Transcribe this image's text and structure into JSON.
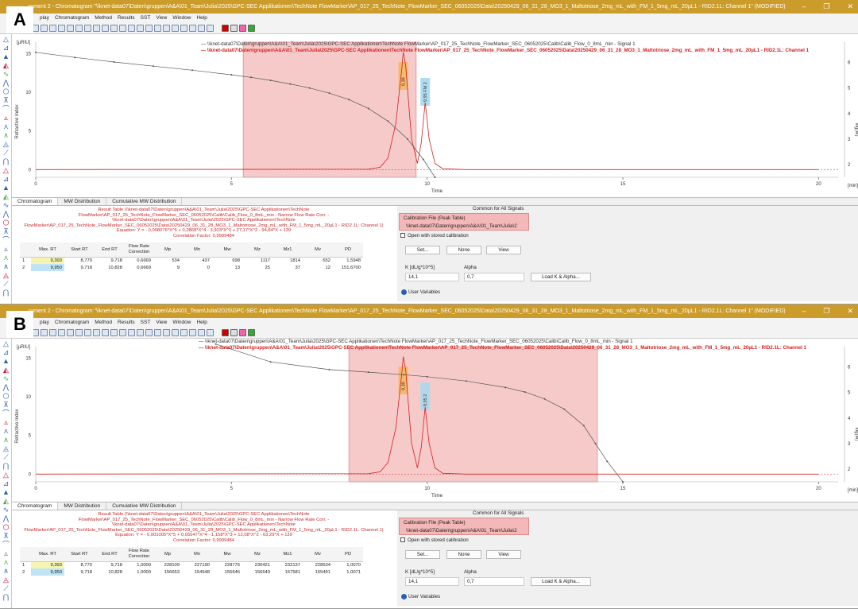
{
  "panels": [
    {
      "label": "A",
      "window_title": "rument 2 - Chromatogram \"\\\\knet-data07\\Daten\\gruppen\\A&A\\01_Team\\Julia\\2025\\GPC-SEC Applikationen\\TechNote FlowMarker\\AP_017_25_TechNote_FlowMarker_SEC_06052025\\Data\\20250429_06_31_28_MO3_1_Maltotriose_2mg_mL_with_FM_1_5mg_mL_20µL1 - RID2.1L: Channel 1\" (MODIFIED)",
      "legend_line1": "— \\\\knet-data07\\Daten\\gruppen\\A&A\\01_Team\\Julia\\2025\\GPC-SEC Applikationen\\TechNote FlowMarker\\AP_017_25_TechNote_FlowMarker_SEC_06052025\\Calib\\Calib_Flow_0_8mL_min - Signal 1",
      "legend_line2": "— \\\\knet-data07\\Daten\\gruppen\\A&A\\01_Team\\Julia\\2025\\GPC-SEC Applikationen\\TechNote FlowMarker\\AP_017_25_TechNote_FlowMarker_SEC_06052025\\Data\\20250429_06_31_28_MO3_1_Maltotriose_2mg_mL_with_FM_1_5mg_mL_20µL1 - RID2.1L: Channel 1",
      "result_info": [
        "Result Table (\\\\knet-data07\\Daten\\gruppen\\A&A\\01_Team\\Julia\\2025\\GPC-SEC Applikationen\\TechNote",
        "FlowMarker\\AP_017_25_TechNote_FlowMarker_SEC_06052025\\Calib\\Calib_Flow_0_8mL_min - Narrow Flow Rate Corr. -",
        "\\\\knet-data07\\Daten\\gruppen\\A&A\\01_Team\\Julia\\2025\\GPC-SEC Applikationen\\TechNote",
        "FlowMarker\\AP_017_25_TechNote_FlowMarker_SEC_06052025\\Data\\20250429_06_31_28_MO3_1_Maltotriose_2mg_mL_with_FM_1_5mg_mL_20µL1 - RID2.1L: Channel 1)",
        "Equation: Y = - 0,008076*X^5 + 0,2868*X^4 - 3,903*X^3 + 27,17*X^2 - 94,84*X + 139",
        "Correlation Factor: 0,9999484"
      ],
      "rows": [
        [
          "1",
          "9,393",
          "8,770",
          "9,718",
          "0,6669",
          "534",
          "437",
          "698",
          "1117",
          "1814",
          "652",
          "1,5948"
        ],
        [
          "2",
          "9,950",
          "9,718",
          "10,828",
          "0,6669",
          "9",
          "0",
          "13",
          "25",
          "37",
          "12",
          "151,6700"
        ]
      ],
      "chart_data": {
        "type": "line",
        "xlabel": "Time",
        "xunit": "[min]",
        "ylabel": "Refractive Index",
        "yunit": "[µRIU]",
        "y2label": "log(M)",
        "xlim": [
          0,
          20.5
        ],
        "ylim": [
          -1,
          16.5
        ],
        "y2lim": [
          1.5,
          6.8
        ],
        "x_ticks": [
          0,
          5,
          10,
          15,
          20
        ],
        "y_ticks": [
          0,
          5,
          10,
          15
        ],
        "y2_ticks": [
          2,
          3,
          4,
          5,
          6
        ],
        "shaded_range": [
          5.3,
          9.72
        ],
        "peak_bands": [
          {
            "label": "9,39",
            "x": 9.39
          },
          {
            "label": "9,95 FM 2",
            "x": 9.95
          }
        ],
        "series": [
          {
            "name": "Calib_Flow_0_8mL_min - Signal 1",
            "axis": "y2",
            "x": [
              0,
              1,
              2,
              3,
              4,
              5,
              5.5,
              6,
              6.5,
              7,
              7.5,
              8,
              8.5,
              9,
              9.5,
              9.9,
              10.2
            ],
            "y": [
              6.4,
              6.2,
              6.02,
              5.86,
              5.7,
              5.52,
              5.42,
              5.3,
              5.16,
              5.0,
              4.8,
              4.55,
              4.2,
              3.7,
              3.0,
              2.2,
              1.5
            ]
          },
          {
            "name": "20250429_06_31_28_MO3_1_Maltotriose - RID2.1L: Channel 1",
            "axis": "y",
            "x": [
              0,
              8.5,
              8.8,
              9.0,
              9.2,
              9.35,
              9.39,
              9.45,
              9.6,
              9.75,
              9.85,
              9.95,
              10.05,
              10.2,
              10.4,
              11,
              20
            ],
            "y": [
              0,
              0.05,
              0.3,
              1.5,
              6.0,
              13.0,
              15.2,
              13.5,
              4.0,
              0.8,
              3.5,
              8.7,
              4.0,
              0.8,
              0.1,
              0,
              0
            ]
          }
        ]
      }
    },
    {
      "label": "B",
      "window_title": "rument 2 - Chromatogram \"\\\\knet-data07\\Daten\\gruppen\\A&A\\01_Team\\Julia\\2025\\GPC-SEC Applikationen\\TechNote FlowMarker\\AP_017_25_TechNote_FlowMarker_SEC_06052025\\Data\\20250429_06_31_28_MO3_1_Maltotriose_2mg_mL_with_FM_1_5mg_mL_20µL1 - RID2.1L: Channel 1\" (MODIFIED)",
      "legend_line1": "— \\\\knet-data07\\Daten\\gruppen\\A&A\\01_Team\\Julia\\2025\\GPC-SEC Applikationen\\TechNote FlowMarker\\AP_017_25_TechNote_FlowMarker_SEC_06052025\\Calib\\Calib_Flow_0_8mL_min - Signal 1",
      "legend_line2": "— \\\\knet-data07\\Daten\\gruppen\\A&A\\01_Team\\Julia\\2025\\GPC-SEC Applikationen\\TechNote FlowMarker\\AP_017_25_TechNote_FlowMarker_SEC_06052025\\Data\\20250429_06_31_28_MO3_1_Maltotriose_2mg_mL_with_FM_1_5mg_mL_20µL1 - RID2.1L: Channel 1",
      "result_info": [
        "Result Table (\\\\knet-data07\\Daten\\gruppen\\A&A\\01_Team\\Julia\\2025\\GPC-SEC Applikationen\\TechNote",
        "FlowMarker\\AP_017_25_TechNote_FlowMarker_SEC_06052025\\Calib\\Calib_Flow_0_8mL_min - Narrow Flow Rate Corr. -",
        "\\\\knet-data07\\Daten\\gruppen\\A&A\\01_Team\\Julia\\2025\\GPC-SEC Applikationen\\TechNote",
        "FlowMarker\\AP_017_25_TechNote_FlowMarker_SEC_06052025\\Data\\20250429_06_31_28_MO3_1_Maltotriose_2mg_mL_with_FM_1_5mg_mL_20µL1 - RID2.1L: Channel 1)",
        "Equation: Y = - 0,001005*X^5 + 0,05547*X^4 - 1,158*X^3 + 12,08*X^2 - 63,29*X + 139",
        "Correlation Factor: 0,9999484"
      ],
      "rows": [
        [
          "1",
          "9,393",
          "8,770",
          "9,718",
          "1,0000",
          "228109",
          "227190",
          "228776",
          "230421",
          "232137",
          "228534",
          "1,0070"
        ],
        [
          "2",
          "9,950",
          "9,718",
          "10,828",
          "1,0000",
          "156653",
          "154548",
          "155646",
          "156649",
          "157581",
          "155491",
          "1,0071"
        ]
      ],
      "chart_data": {
        "type": "line",
        "xlabel": "Time",
        "xunit": "[min]",
        "ylabel": "Refractive Index",
        "yunit": "[µRIU]",
        "y2label": "log(M)",
        "xlim": [
          0,
          20.5
        ],
        "ylim": [
          -1,
          16.5
        ],
        "y2lim": [
          1.5,
          6.8
        ],
        "x_ticks": [
          0,
          5,
          10,
          15,
          20
        ],
        "y_ticks": [
          0,
          5,
          10,
          15
        ],
        "y2_ticks": [
          2,
          3,
          4,
          5,
          6
        ],
        "shaded_range": [
          8.0,
          14.35
        ],
        "peak_bands": [
          {
            "label": "9,39",
            "x": 9.39
          },
          {
            "label": "9,95 2",
            "x": 9.95
          }
        ],
        "series": [
          {
            "name": "Calib_Flow_0_8mL_min - Signal 1",
            "axis": "y2",
            "x": [
              4.6,
              6,
              7.5,
              8.5,
              9.4,
              10,
              11,
              12,
              12.5,
              13,
              13.5,
              14,
              14.3,
              14.6,
              15.0
            ],
            "y": [
              6.9,
              6.2,
              5.9,
              5.8,
              5.7,
              5.62,
              5.45,
              5.2,
              5.02,
              4.75,
              4.35,
              3.7,
              3.0,
              2.3,
              1.5
            ]
          },
          {
            "name": "20250429_06_31_28_MO3_1_Maltotriose - RID2.1L: Channel 1",
            "axis": "y",
            "x": [
              0,
              8.5,
              8.8,
              9.0,
              9.2,
              9.35,
              9.39,
              9.45,
              9.6,
              9.75,
              9.85,
              9.95,
              10.05,
              10.2,
              10.4,
              11,
              20
            ],
            "y": [
              0,
              0.05,
              0.3,
              1.5,
              6.0,
              13.0,
              15.2,
              13.5,
              4.0,
              0.8,
              3.5,
              8.7,
              4.0,
              0.8,
              0.1,
              0,
              0
            ]
          }
        ]
      }
    }
  ],
  "common": {
    "window_buttons": [
      "–",
      "❐",
      "✕"
    ],
    "menu": [
      "play",
      "Chromatogram",
      "Method",
      "Results",
      "SST",
      "View",
      "Window",
      "Help"
    ],
    "tabs": [
      "Chromatogram",
      "MW Distribution",
      "Cumulative MW Distribution"
    ],
    "table_headers": [
      "",
      "Max. RT",
      "Start RT",
      "End RT",
      "Flow Rate Correction",
      "Mp",
      "Mn",
      "Mw",
      "Mz",
      "Mz1",
      "Mv",
      "PD"
    ],
    "common_signals": "Common for All Signals",
    "cal_file_label": "Calibration File (Peak Table)",
    "cal_file_value": "\\\\knet-data07\\Daten\\gruppen\\A&A\\01_Team\\Julia\\2",
    "open_stored": "Open with stored calibration",
    "btn_set": "Set...",
    "btn_none": "None",
    "btn_view": "View",
    "k_label": "K [dL/g*10^5]",
    "alpha_label": "Alpha",
    "k_value": "14,1",
    "alpha_value": "0,7",
    "btn_load": "Load K & Alpha...",
    "user_variables": "User Variables",
    "colors": {
      "titlebar": "#cc9c2a",
      "shade": "#f4b8b8",
      "sample": "#d42020",
      "calib": "#555555",
      "band_orange": "#f5b860",
      "band_blue": "#a8d8ee"
    }
  }
}
